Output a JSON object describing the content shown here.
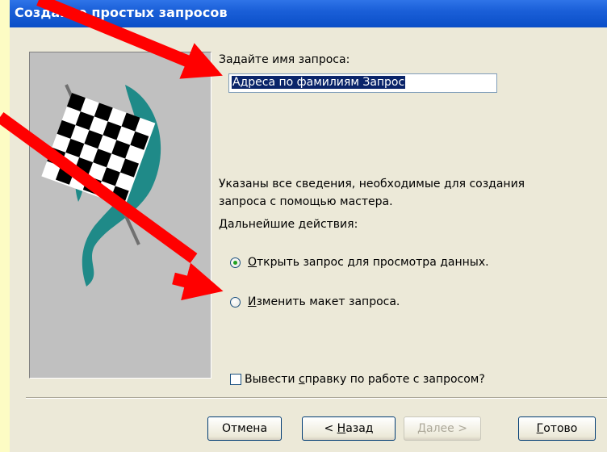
{
  "window": {
    "title": "Создание простых запросов"
  },
  "query_name": {
    "label": "Задайте имя запроса:",
    "value": "Адреса по фамилиям Запрос"
  },
  "info": {
    "line1": "Указаны все сведения, необходимые для создания",
    "line2": "запроса с помощью мастера.",
    "next_actions_label": "Дальнейшие действия:"
  },
  "options": [
    {
      "mnemonic": "О",
      "rest": "ткрыть запрос для просмотра данных.",
      "checked": true
    },
    {
      "mnemonic": "И",
      "rest": "зменить макет запроса.",
      "checked": false
    }
  ],
  "help_checkbox": {
    "before": "Вывести ",
    "mnemonic": "с",
    "after": "правку по работе с запросом?",
    "checked": false
  },
  "buttons": {
    "cancel": "Отмена",
    "back_prefix": "< ",
    "back_mnemonic": "Н",
    "back_rest": "азад",
    "next_mnemonic": "Д",
    "next_rest": "алее >",
    "finish_mnemonic": "Г",
    "finish_rest": "отово"
  },
  "colors": {
    "background": "#fdfcc4",
    "dialog": "#ece9d8",
    "titlebar": "#0a4ec7",
    "arrow": "#ff0000",
    "flag_accent": "#1f8a88"
  }
}
